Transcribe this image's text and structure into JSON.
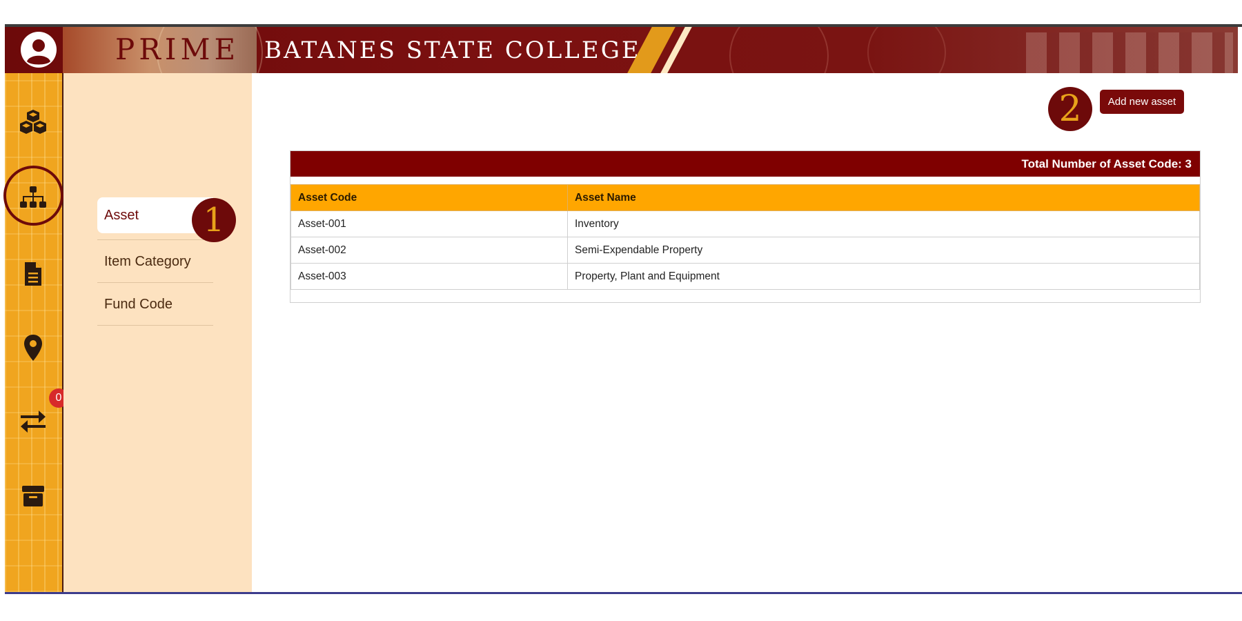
{
  "header": {
    "logo_text": "PRIME",
    "college_title": "BATANES STATE COLLEGE"
  },
  "rail": {
    "items": [
      {
        "icon": "cubes-icon"
      },
      {
        "icon": "sitemap-icon",
        "active": true
      },
      {
        "icon": "document-icon"
      },
      {
        "icon": "location-pin-icon"
      },
      {
        "icon": "transfer-arrows-icon",
        "badge": "0"
      },
      {
        "icon": "archive-box-icon"
      }
    ]
  },
  "submenu": {
    "items": [
      {
        "label": "Asset",
        "active": true
      },
      {
        "label": "Item Category"
      },
      {
        "label": "Fund Code"
      }
    ]
  },
  "steps": {
    "one": "1",
    "two": "2"
  },
  "main": {
    "add_button": "Add new asset",
    "total_label": "Total Number of Asset Code: 3",
    "columns": [
      "Asset Code",
      "Asset Name"
    ],
    "rows": [
      [
        "Asset-001",
        "Inventory"
      ],
      [
        "Asset-002",
        "Semi-Expendable Property"
      ],
      [
        "Asset-003",
        "Property, Plant and Equipment"
      ]
    ]
  },
  "colors": {
    "brand_maroon": "#7f0000",
    "accent_orange": "#ffa600",
    "sidebar_bg": "#fde2c0"
  }
}
